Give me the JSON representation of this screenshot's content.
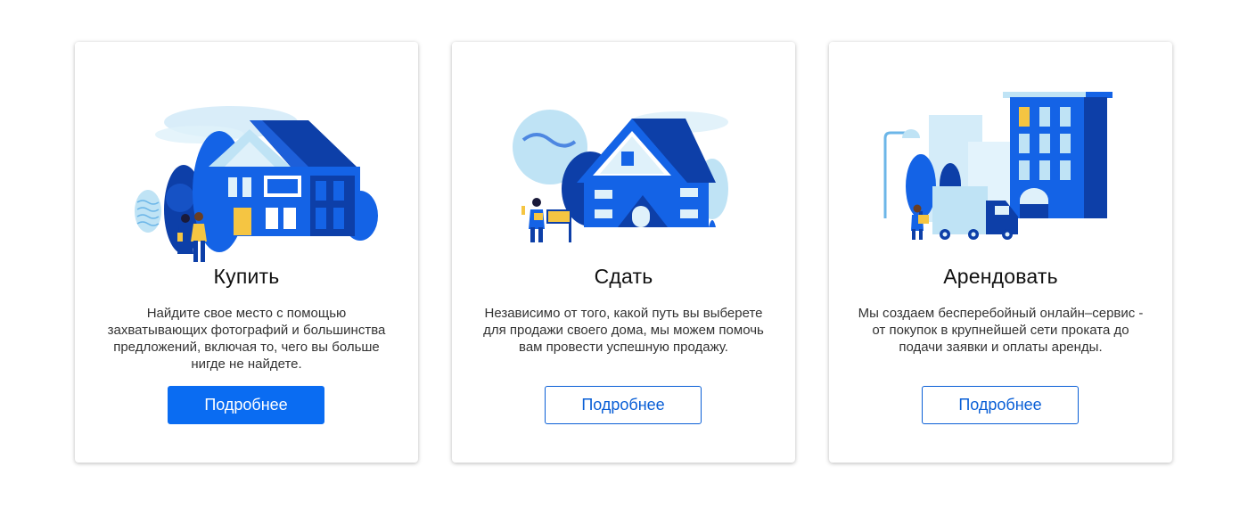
{
  "colors": {
    "accent": "#0a6cf2",
    "dark_blue": "#0d3fa8",
    "light_blue": "#bfe3f5",
    "yellow": "#f5c542"
  },
  "cards": [
    {
      "title": "Купить",
      "description": "Найдите свое место с помощью захватывающих фотографий и большинства предложений, включая то, чего вы больше нигде не найдете.",
      "button_label": "Подробнее",
      "button_style": "filled",
      "illustration": "house-with-couple-illustration"
    },
    {
      "title": "Сдать",
      "description": "Независимо от того, какой путь вы выберете для продажи своего дома, мы можем помочь вам провести успешную продажу.",
      "button_label": "Подробнее",
      "button_style": "outline",
      "illustration": "house-with-agent-and-sign-illustration"
    },
    {
      "title": "Арендовать",
      "description": "Мы создаем бесперебойный онлайн–сервис - от покупок в крупнейшей сети проката до подачи заявки и оплаты аренды.",
      "button_label": "Подробнее",
      "button_style": "outline",
      "illustration": "city-building-with-truck-illustration"
    }
  ]
}
